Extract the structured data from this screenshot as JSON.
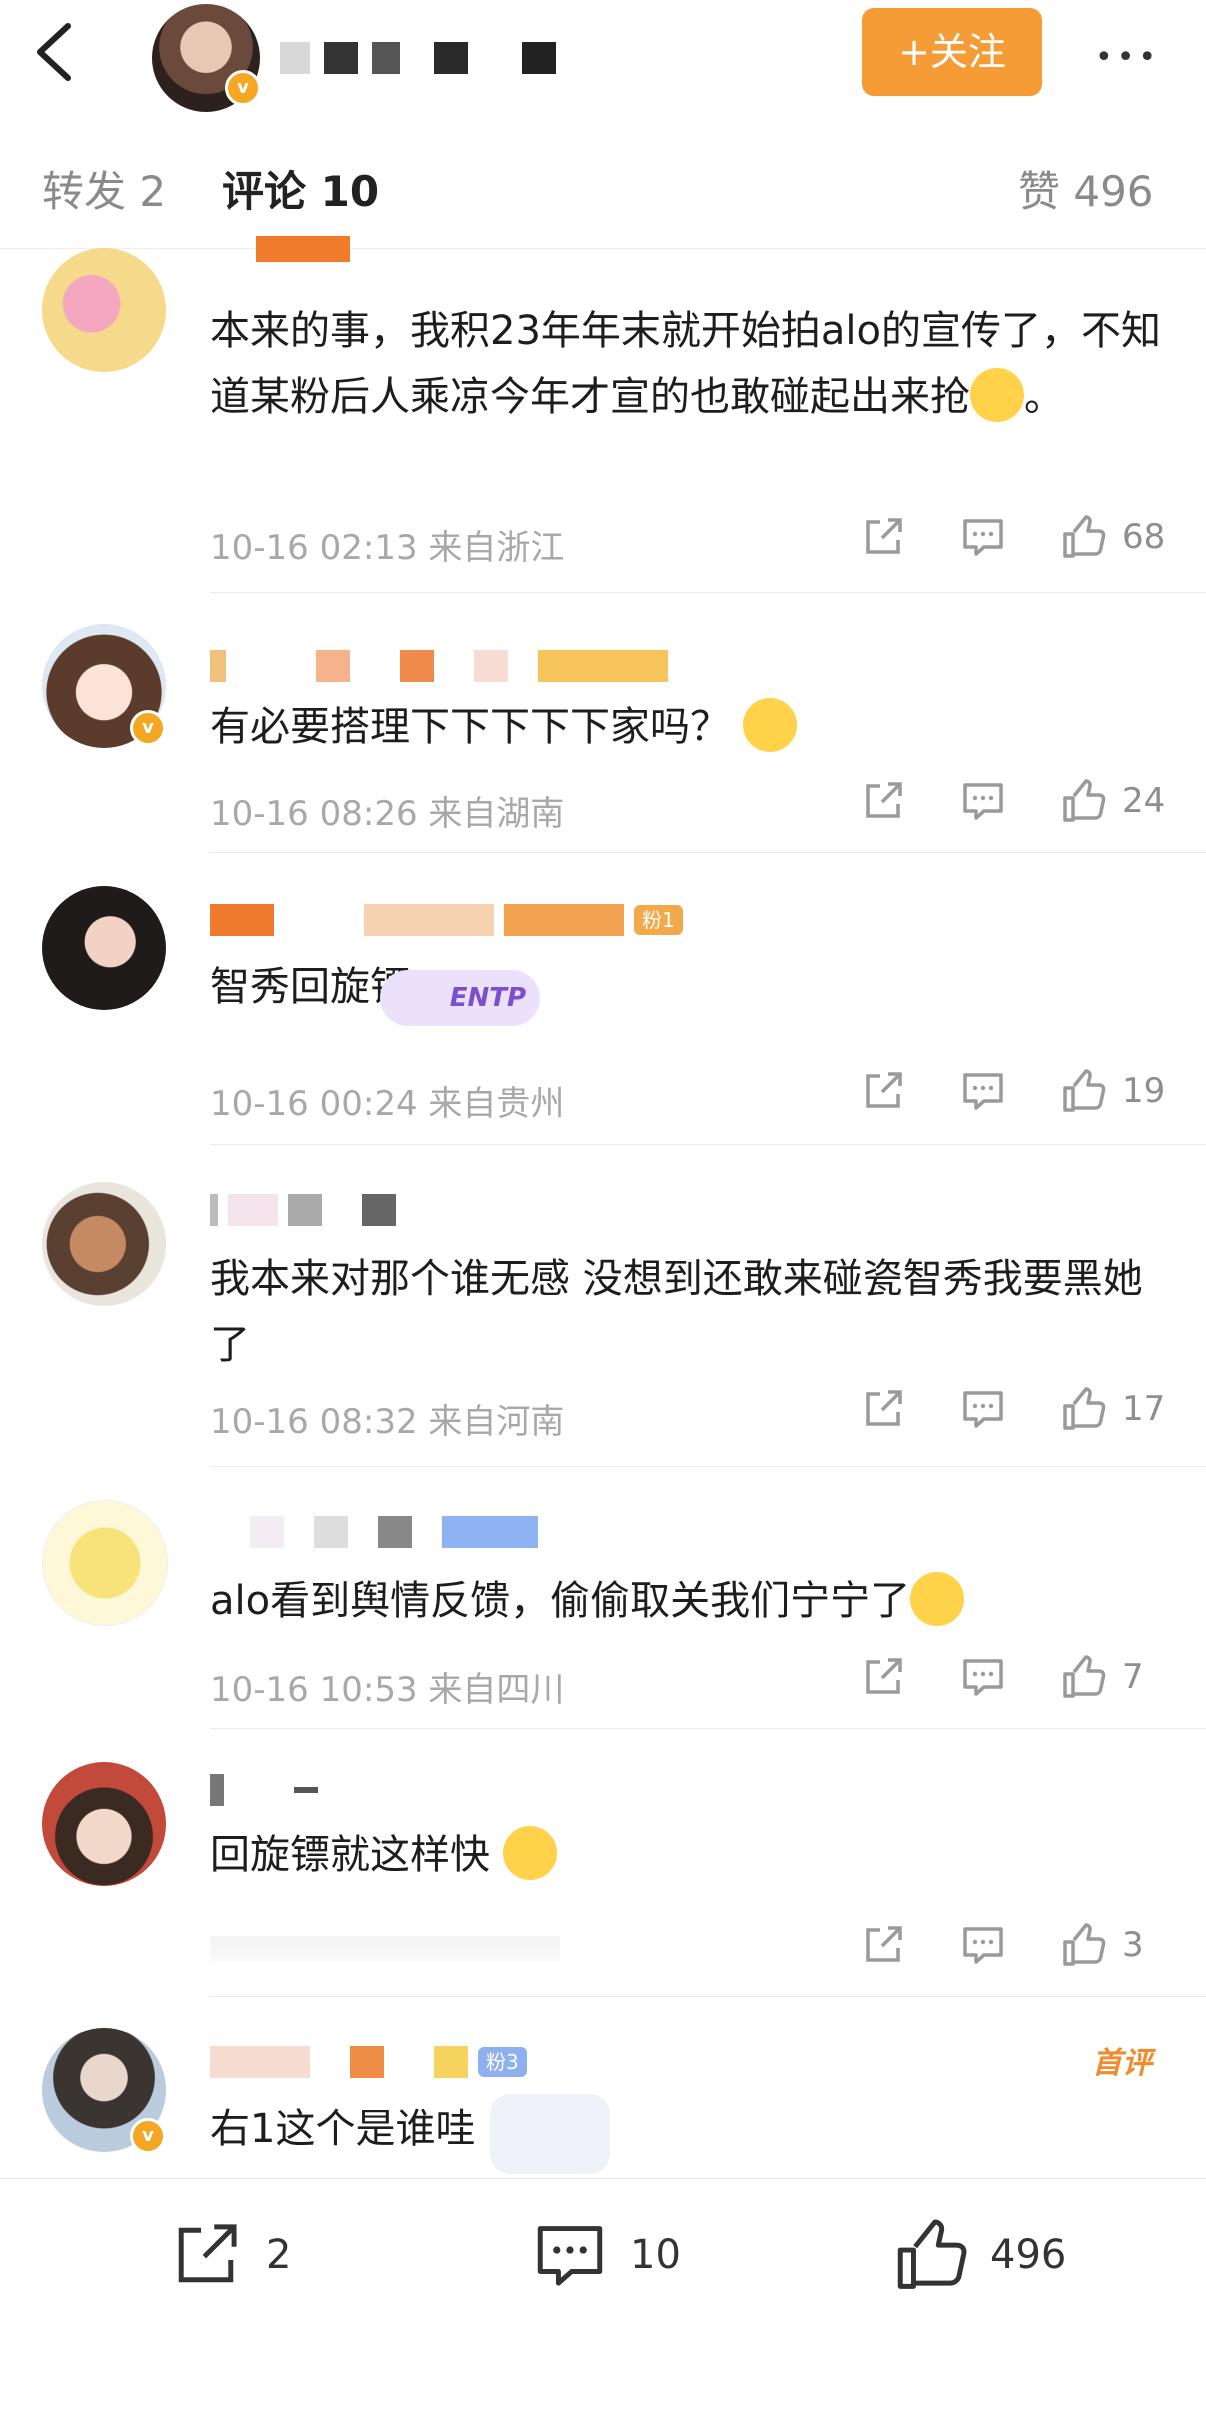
{
  "header": {
    "follow_label": "+关注",
    "more_label": "•••"
  },
  "tabs": [
    {
      "label": "转发 2"
    },
    {
      "label": "评论 10"
    },
    {
      "label": "赞 496"
    }
  ],
  "comments": [
    {
      "text": "本来的事，我积23年年末就开始拍alo的宣传了，不知道某粉后人乘凉今年才宣的也敢碰起出来抢",
      "text_tail": "。",
      "time": "10-16 02:13 来自浙江",
      "likes": "68"
    },
    {
      "text": "有必要搭理下下下下下家吗？",
      "time": "10-16 08:26 来自湖南",
      "likes": "24"
    },
    {
      "text": "智秀回旋镖",
      "time": "10-16 00:24 来自贵州",
      "likes": "19",
      "fan_badge": "粉1",
      "sticker_text": "ENTP"
    },
    {
      "text": "我本来对那个谁无感 没想到还敢来碰瓷智秀我要黑她了",
      "time": "10-16 08:32 来自河南",
      "likes": "17"
    },
    {
      "text": "alo看到舆情反馈，偷偷取关我们宁宁了",
      "time": "10-16 10:53 来自四川",
      "likes": "7"
    },
    {
      "text": "回旋镖就这样快",
      "time": "",
      "likes": "3"
    },
    {
      "text": "右1这个是谁哇",
      "fan_badge": "粉3",
      "first_tag": "首评"
    }
  ],
  "bottom_bar": {
    "reposts": "2",
    "comments": "10",
    "likes": "496"
  },
  "colors": {
    "accent_orange": "#f59c36",
    "vip_badge": "#f5a623"
  }
}
